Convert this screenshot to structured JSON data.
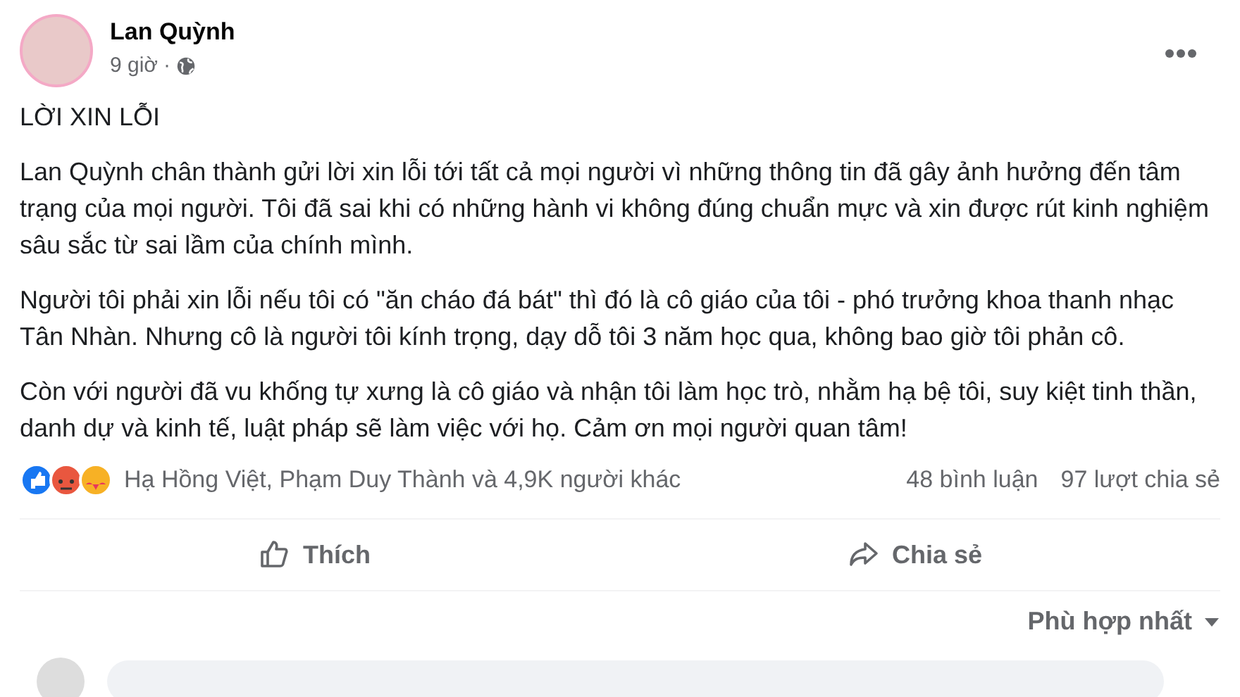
{
  "post": {
    "author": "Lan Quỳnh",
    "time": "9 giờ",
    "separator": "·",
    "title": "LỜI XIN LỖI",
    "paragraphs": [
      "Lan Quỳnh chân thành gửi lời xin lỗi tới tất cả mọi người vì những thông tin đã gây ảnh hưởng đến tâm trạng của mọi người. Tôi đã sai khi có những hành vi không đúng chuẩn mực và xin được rút kinh nghiệm sâu sắc từ sai lầm của chính mình.",
      "Người tôi phải xin lỗi nếu tôi có \"ăn cháo đá bát\" thì đó là cô giáo của tôi - phó trưởng khoa thanh nhạc Tân Nhàn. Nhưng cô là người tôi kính trọng, dạy dỗ tôi 3 năm học qua, không bao giờ tôi phản cô.",
      "Còn với người đã vu khống tự xưng là cô giáo và nhận tôi làm học trò, nhằm hạ bệ tôi, suy kiệt tinh thần, danh dự và kinh tế, luật pháp sẽ làm việc với họ. Cảm ơn mọi người quan tâm!"
    ]
  },
  "reactions": {
    "summary": "Hạ Hồng Việt, Phạm Duy Thành và 4,9K người khác",
    "comments": "48 bình luận",
    "shares": "97 lượt chia sẻ"
  },
  "actions": [
    {
      "kind": "like",
      "label": "Thích"
    },
    {
      "kind": "share",
      "label": "Chia sẻ"
    }
  ],
  "sort": {
    "label": "Phù hợp nhất"
  }
}
